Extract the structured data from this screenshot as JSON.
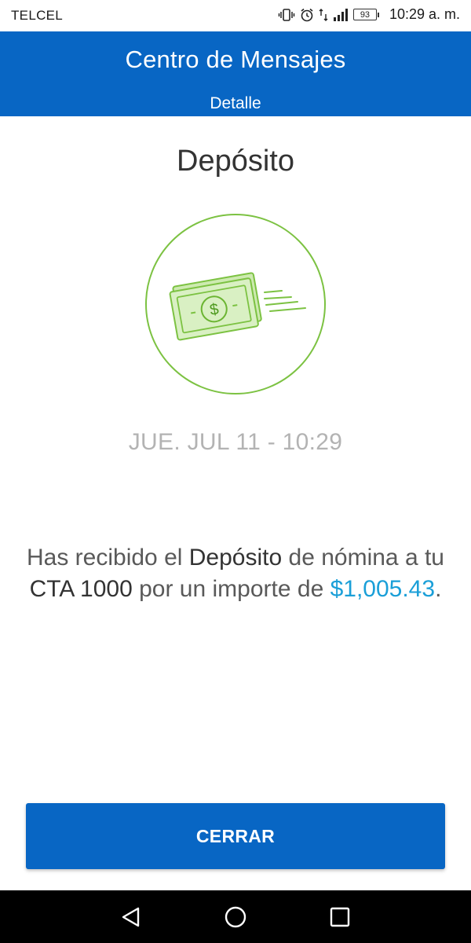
{
  "status_bar": {
    "carrier": "TELCEL",
    "battery": "93",
    "time": "10:29 a. m.",
    "icons": [
      "vibrate-icon",
      "alarm-icon",
      "data-arrows-icon",
      "signal-icon",
      "battery-icon"
    ]
  },
  "header": {
    "title": "Centro de Mensajes",
    "subtitle": "Detalle"
  },
  "message": {
    "title": "Depósito",
    "icon": "money-bill-icon",
    "date": "JUE. JUL 11 - 10:29",
    "body": {
      "part1": "Has recibido el ",
      "bold1": "Depósito",
      "part2": " de nómina a tu ",
      "bold2": "CTA 1000",
      "part3": " por un importe de ",
      "amount": "$1,005.43",
      "end": "."
    }
  },
  "actions": {
    "close_label": "CERRAR"
  },
  "nav_bar": {
    "icons": [
      "back-icon",
      "home-icon",
      "recent-apps-icon"
    ]
  },
  "colors": {
    "primary": "#0866c4",
    "accent_green": "#7cc242",
    "amount": "#1a9fd8",
    "date_gray": "#b3b3b3"
  }
}
